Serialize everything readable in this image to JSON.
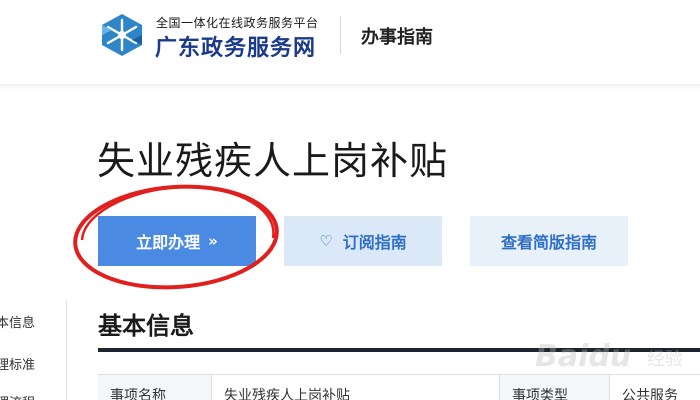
{
  "header": {
    "brand_sub": "全国一体化在线政务服务平台",
    "brand_main": "广东政务服务网",
    "nav_label": "办事指南",
    "logo_icon": "snowflake-logo-icon",
    "brand_color": "#1b3a8c"
  },
  "main": {
    "title": "失业残疾人上岗补贴",
    "buttons": {
      "apply": {
        "label": "立即办理",
        "icon": "double-chevron-right-icon",
        "glyph": "»"
      },
      "subscribe": {
        "label": "订阅指南",
        "icon": "heart-icon",
        "glyph": "♡"
      },
      "simple": {
        "label": "查看简版指南"
      }
    },
    "section_title": "基本信息",
    "table": {
      "row1": [
        "事项名称",
        "失业残疾人上岗补贴",
        "事项类型",
        "公共服务"
      ]
    }
  },
  "side_nav": {
    "items": [
      "本信息",
      "理标准",
      "理流程"
    ]
  },
  "colors": {
    "primary_button": "#4b8ae3",
    "subscribe_button": "#dbe8f7",
    "simple_button": "#e8f0f9",
    "annotation": "#e0201f"
  },
  "watermark": {
    "text": "Baidu",
    "text_cn": "经验"
  }
}
